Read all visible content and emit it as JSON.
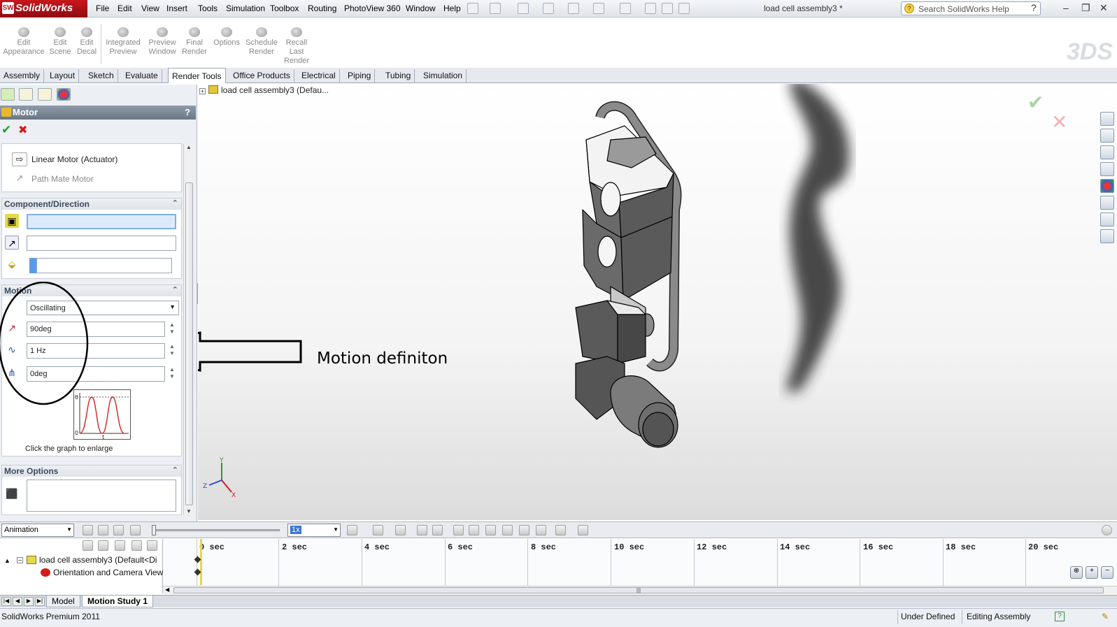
{
  "app": {
    "logo": "SolidWorks",
    "document_title": "load cell assembly3 *",
    "menu": [
      "File",
      "Edit",
      "View",
      "Insert",
      "Tools",
      "Simulation",
      "Toolbox",
      "Routing",
      "PhotoView 360",
      "Window",
      "Help"
    ],
    "search_placeholder": "Search SolidWorks Help",
    "win_help": "?"
  },
  "commands": [
    {
      "label": "Edit\nAppearance"
    },
    {
      "label": "Edit\nScene"
    },
    {
      "label": "Edit\nDecal"
    },
    {
      "label": "Integrated\nPreview"
    },
    {
      "label": "Preview\nWindow"
    },
    {
      "label": "Final\nRender"
    },
    {
      "label": "Options"
    },
    {
      "label": "Schedule\nRender"
    },
    {
      "label": "Recall\nLast\nRender"
    }
  ],
  "tabs": [
    "Assembly",
    "Layout",
    "Sketch",
    "Evaluate",
    "Render Tools",
    "Office Products",
    "Electrical",
    "Piping",
    "Tubing",
    "Simulation"
  ],
  "active_tab": "Render Tools",
  "pm": {
    "title": "Motor",
    "help": "?",
    "motor_types": [
      {
        "label": "Linear Motor (Actuator)",
        "enabled": true
      },
      {
        "label": "Path Mate Motor",
        "enabled": false
      }
    ],
    "component_group": "Component/Direction",
    "motion_group": "Motion",
    "motion_type": "Oscillating",
    "amplitude": "90deg",
    "frequency": "1 Hz",
    "phase_shift": "0deg",
    "graph_axis_y": "θ",
    "graph_axis_zero": "0",
    "graph_axis_x": "t",
    "graph_caption": "Click the graph to enlarge",
    "more_options_group": "More Options"
  },
  "graphics": {
    "tree_flyout": "load cell assembly3  (Defau...",
    "annotation": "Motion definiton",
    "triad": {
      "x": "X",
      "y": "Y",
      "z": "Z"
    }
  },
  "motion_manager": {
    "study_type": "Animation",
    "playback_speed": "1x",
    "ticks": [
      "0 sec",
      "2 sec",
      "4 sec",
      "6 sec",
      "8 sec",
      "10 sec",
      "12 sec",
      "14 sec",
      "16 sec",
      "18 sec",
      "20 sec"
    ],
    "tree": [
      {
        "label": "load cell assembly3  (Default<Di"
      },
      {
        "label": "Orientation and Camera View"
      }
    ]
  },
  "doc_tabs": [
    "Model",
    "Motion Study 1"
  ],
  "active_doc_tab": "Motion Study 1",
  "status": {
    "product": "SolidWorks Premium 2011",
    "state": "Under Defined",
    "mode": "Editing Assembly",
    "help": "?"
  },
  "colors": {
    "brand": "#c9161d",
    "accept": "#1f9e2f",
    "reject": "#d21c1c",
    "graph_curve": "#d41f1f",
    "selection": "#dcebfb"
  }
}
